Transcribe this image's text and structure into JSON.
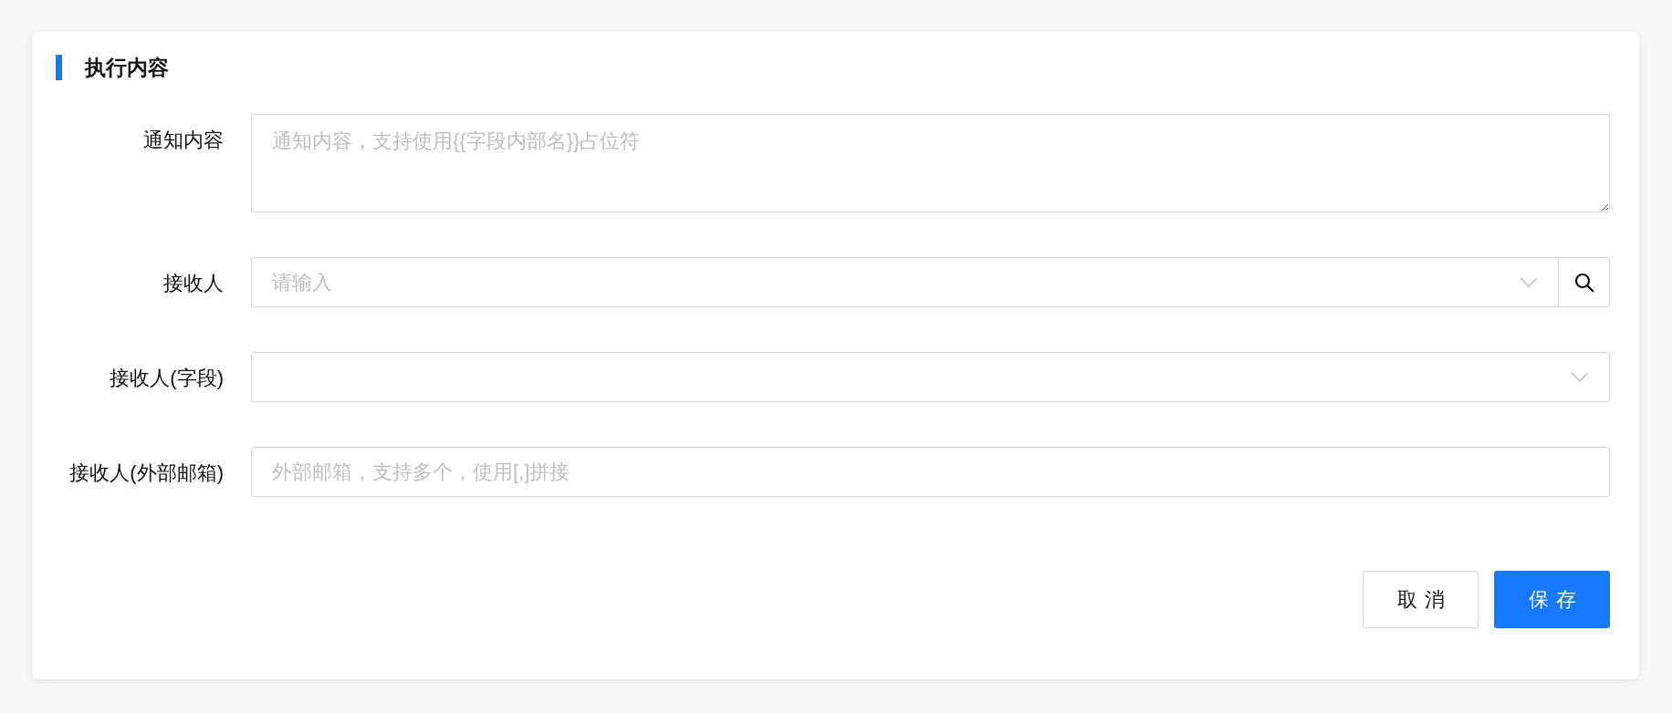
{
  "section": {
    "title": "执行内容"
  },
  "fields": [
    {
      "kind": "textarea",
      "label": "通知内容",
      "placeholder": "通知内容，支持使用{{字段内部名}}占位符"
    },
    {
      "kind": "search-select",
      "label": "接收人",
      "placeholder": "请输入"
    },
    {
      "kind": "select",
      "label": "接收人(字段)"
    },
    {
      "kind": "input",
      "label": "接收人(外部邮箱)",
      "placeholder": "外部邮箱，支持多个，使用[,]拼接"
    }
  ],
  "buttons": [
    {
      "label": "取消",
      "kind": "default"
    },
    {
      "label": "保存",
      "kind": "primary"
    }
  ]
}
